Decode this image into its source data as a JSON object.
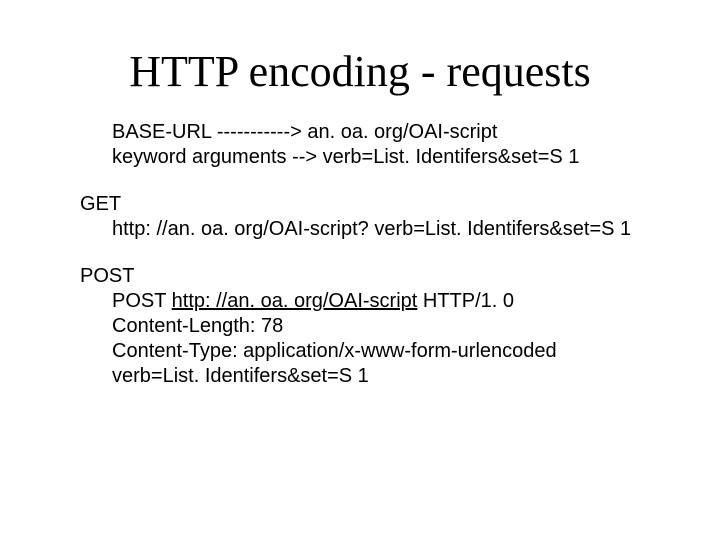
{
  "title": "HTTP encoding - requests",
  "intro": {
    "line1": "BASE-URL -----------> an. oa. org/OAI-script",
    "line2": "keyword arguments --> verb=List. Identifers&set=S 1"
  },
  "get": {
    "head": "GET",
    "line1": "http: //an. oa. org/OAI-script? verb=List. Identifers&set=S 1"
  },
  "post": {
    "head": "POST",
    "line1_prefix": "POST ",
    "line1_link": "http: //an. oa. org/OAI-script",
    "line1_suffix": " HTTP/1. 0",
    "line2": "Content-Length: 78",
    "line3": "Content-Type: application/x-www-form-urlencoded",
    "line4": "verb=List. Identifers&set=S 1"
  }
}
